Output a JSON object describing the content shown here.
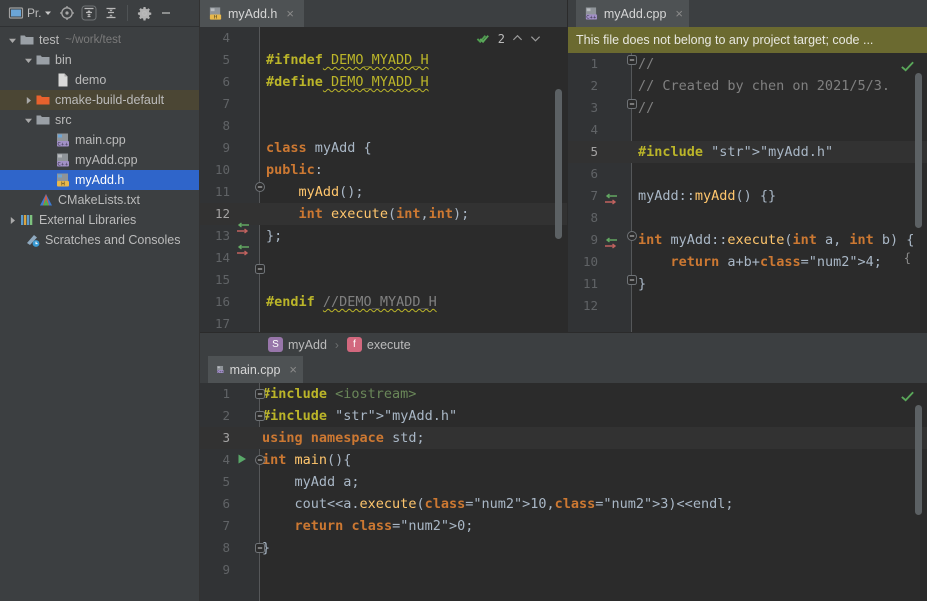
{
  "project_panel": {
    "toolbar": {
      "project_label": "Pr.",
      "buttons": [
        {
          "name": "project-view-selector",
          "label": "Pr."
        },
        {
          "name": "locate-icon",
          "label": "Select Opened File"
        },
        {
          "name": "expand-all-icon",
          "label": "Expand All"
        },
        {
          "name": "collapse-all-icon",
          "label": "Collapse All"
        },
        {
          "name": "gear-icon",
          "label": "Options"
        },
        {
          "name": "minimize-icon",
          "label": "Hide"
        }
      ]
    },
    "tree": [
      {
        "label": "test",
        "sub": "~/work/test",
        "indent": 0,
        "twisty": "down",
        "icon": "folder",
        "state": "normal"
      },
      {
        "label": "bin",
        "sub": "",
        "indent": 1,
        "twisty": "down",
        "icon": "folder",
        "state": "normal"
      },
      {
        "label": "demo",
        "sub": "",
        "indent": 2,
        "twisty": "none",
        "icon": "file",
        "state": "normal"
      },
      {
        "label": "cmake-build-default",
        "sub": "",
        "indent": 1,
        "twisty": "right",
        "icon": "folder-orange",
        "state": "highlighted"
      },
      {
        "label": "src",
        "sub": "",
        "indent": 1,
        "twisty": "down",
        "icon": "folder",
        "state": "normal"
      },
      {
        "label": "main.cpp",
        "sub": "",
        "indent": 2,
        "twisty": "none",
        "icon": "cpp",
        "state": "normal"
      },
      {
        "label": "myAdd.cpp",
        "sub": "",
        "indent": 2,
        "twisty": "none",
        "icon": "cpp",
        "state": "normal"
      },
      {
        "label": "myAdd.h",
        "sub": "",
        "indent": 2,
        "twisty": "none",
        "icon": "header",
        "state": "selected"
      },
      {
        "label": "CMakeLists.txt",
        "sub": "",
        "indent": 1,
        "twisty": "none",
        "icon": "cmake",
        "state": "normal"
      },
      {
        "label": "External Libraries",
        "sub": "",
        "indent": 0,
        "twisty": "right",
        "icon": "libraries",
        "state": "normal"
      },
      {
        "label": "Scratches and Consoles",
        "sub": "",
        "indent": 0,
        "twisty": "none",
        "icon": "scratches",
        "state": "normal"
      }
    ]
  },
  "editors": {
    "left_top": {
      "tab": {
        "title": "myAdd.h",
        "icon": "header",
        "close": "×"
      },
      "inspection": {
        "count": "2",
        "up": "⌃",
        "down": "⌄"
      },
      "first_line": 4,
      "lines": [
        {
          "n": 4,
          "text": "",
          "current": false
        },
        {
          "n": 5,
          "text": "#ifndef DEMO_MYADD_H",
          "current": false
        },
        {
          "n": 6,
          "text": "#define DEMO_MYADD_H",
          "current": false
        },
        {
          "n": 7,
          "text": "",
          "current": false
        },
        {
          "n": 8,
          "text": "",
          "current": false
        },
        {
          "n": 9,
          "text": "class myAdd {",
          "current": false
        },
        {
          "n": 10,
          "text": "public:",
          "current": false
        },
        {
          "n": 11,
          "text": "    myAdd();",
          "current": false
        },
        {
          "n": 12,
          "text": "    int execute(int,int);",
          "current": true
        },
        {
          "n": 13,
          "text": "};",
          "current": false
        },
        {
          "n": 14,
          "text": "",
          "current": false
        },
        {
          "n": 15,
          "text": "",
          "current": false
        },
        {
          "n": 16,
          "text": "#endif //DEMO_MYADD_H",
          "current": false
        },
        {
          "n": 17,
          "text": "",
          "current": false
        }
      ]
    },
    "right_top": {
      "tab": {
        "title": "myAdd.cpp",
        "icon": "cpp",
        "close": "×"
      },
      "banner": "This file does not belong to any project target; code ...",
      "lines": [
        {
          "n": 1,
          "text": "//",
          "current": false
        },
        {
          "n": 2,
          "text": "// Created by chen on 2021/5/3.",
          "current": false
        },
        {
          "n": 3,
          "text": "//",
          "current": false
        },
        {
          "n": 4,
          "text": "",
          "current": false
        },
        {
          "n": 5,
          "text": "#include \"myAdd.h\"",
          "current": true
        },
        {
          "n": 6,
          "text": "",
          "current": false
        },
        {
          "n": 7,
          "text": "myAdd::myAdd() {}",
          "current": false
        },
        {
          "n": 8,
          "text": "",
          "current": false
        },
        {
          "n": 9,
          "text": "int myAdd::execute(int a, int b) {",
          "current": false
        },
        {
          "n": 10,
          "text": "    return a+b+4;",
          "current": false
        },
        {
          "n": 11,
          "text": "}",
          "current": false
        },
        {
          "n": 12,
          "text": "",
          "current": false
        }
      ]
    },
    "bottom": {
      "tab": {
        "title": "main.cpp",
        "icon": "cpp",
        "close": "×"
      },
      "lines": [
        {
          "n": 1,
          "text": "#include <iostream>",
          "current": false
        },
        {
          "n": 2,
          "text": "#include \"myAdd.h\"",
          "current": false
        },
        {
          "n": 3,
          "text": "using namespace std;",
          "current": true
        },
        {
          "n": 4,
          "text": "int main(){",
          "current": false
        },
        {
          "n": 5,
          "text": "    myAdd a;",
          "current": false
        },
        {
          "n": 6,
          "text": "    cout<<a.execute(10,3)<<endl;",
          "current": false
        },
        {
          "n": 7,
          "text": "    return 0;",
          "current": false
        },
        {
          "n": 8,
          "text": "}",
          "current": false
        },
        {
          "n": 9,
          "text": "",
          "current": false
        }
      ]
    }
  },
  "breadcrumb": {
    "items": [
      {
        "badge": "S",
        "label": "myAdd",
        "color": "#9876aa"
      },
      {
        "badge": "f",
        "label": "execute",
        "color": "#d2687e"
      }
    ],
    "separator": "›"
  },
  "colors": {
    "selection_blue": "#2f65ca",
    "banner_olive": "#6b6a30",
    "keyword_orange": "#cc7832",
    "preprocessor_yellow": "#bbb529",
    "string_green": "#6a8759",
    "number_blue": "#6897bb",
    "function_gold": "#ffc66d",
    "comment_gray": "#808080",
    "editor_bg": "#2b2b2b",
    "panel_bg": "#3c3f41"
  }
}
